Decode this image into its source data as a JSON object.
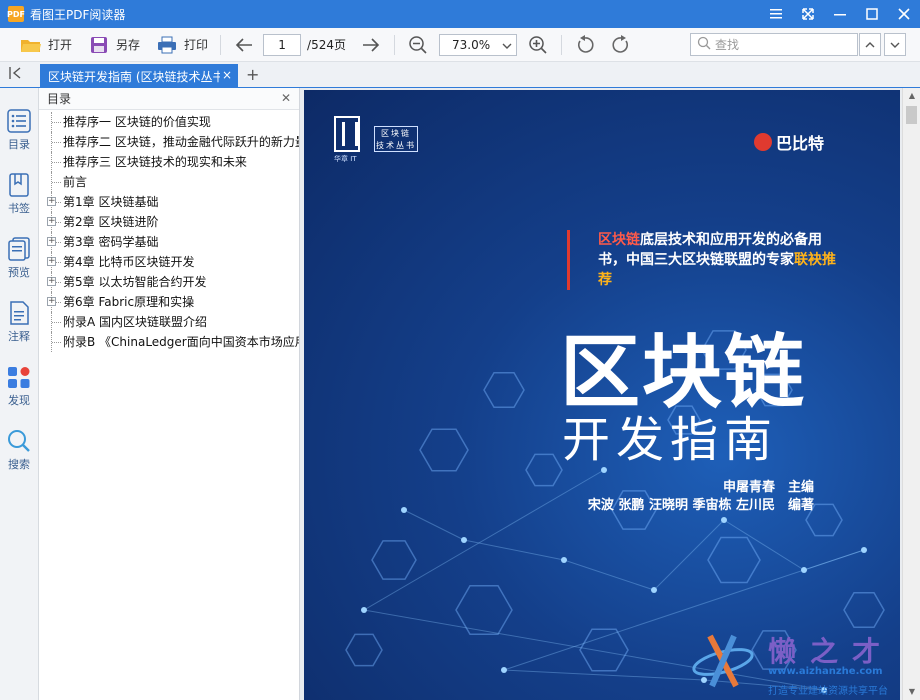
{
  "app": {
    "title": "看图王PDF阅读器",
    "logo_text": "PDF"
  },
  "toolbar": {
    "open_label": "打开",
    "save_label": "另存",
    "print_label": "打印",
    "page_current": "1",
    "page_total": "/524页",
    "zoom": "73.0%",
    "search_placeholder": "查找"
  },
  "tab": {
    "title": "区块链开发指南 (区块链技术丛书)",
    "close": "×",
    "new": "+"
  },
  "sidebar": {
    "items": [
      {
        "label": "目录",
        "icon": "list-icon"
      },
      {
        "label": "书签",
        "icon": "bookmark-icon"
      },
      {
        "label": "预览",
        "icon": "pages-icon"
      },
      {
        "label": "注释",
        "icon": "note-icon"
      },
      {
        "label": "发现",
        "icon": "apps-icon"
      },
      {
        "label": "搜索",
        "icon": "search-icon"
      }
    ]
  },
  "toc": {
    "header": "目录",
    "items": [
      {
        "label": "推荐序一 区块链的价值实现",
        "expandable": false
      },
      {
        "label": "推荐序二 区块链，推动金融代际跃升的新力量",
        "expandable": false
      },
      {
        "label": "推荐序三 区块链技术的现实和未来",
        "expandable": false
      },
      {
        "label": "前言",
        "expandable": false
      },
      {
        "label": "第1章 区块链基础",
        "expandable": true
      },
      {
        "label": "第2章 区块链进阶",
        "expandable": true
      },
      {
        "label": "第3章 密码学基础",
        "expandable": true
      },
      {
        "label": "第4章 比特币区块链开发",
        "expandable": true
      },
      {
        "label": "第5章 以太坊智能合约开发",
        "expandable": true
      },
      {
        "label": "第6章 Fabric原理和实操",
        "expandable": true
      },
      {
        "label": "附录A 国内区块链联盟介绍",
        "expandable": false
      },
      {
        "label": "附录B 《ChinaLedger面向中国资本市场应用的分布式账本》",
        "expandable": false
      }
    ]
  },
  "cover": {
    "bz_text": "华章 IT",
    "series_line1": "区块链",
    "series_line2": "技术丛书",
    "publisher": "巴比特",
    "tagline_red": "区块链",
    "tagline_mid": "底层技术和应用开发的必备用书，中国三大区块链联盟的专家",
    "tagline_yel": "联袂推荐",
    "title": "区块链",
    "subtitle": "开发指南",
    "editor": "申屠青春　主编",
    "authors": "宋波 张鹏 汪晓明 季宙栋 左川民　编著"
  },
  "watermark": {
    "name": "懒之才",
    "url": "www.aizhanzhe.com",
    "slogan": "打造专业建站资源共享平台"
  }
}
